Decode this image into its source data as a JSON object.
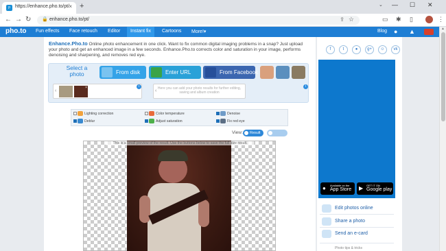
{
  "browser": {
    "tab_title": "https://enhance.pho.to/pt/",
    "url": "enhance.pho.to/pt/",
    "new_tab": "+",
    "close_tab": "×",
    "back": "←",
    "forward": "→",
    "reload": "↻",
    "minimize": "—",
    "maximize": "☐",
    "close_window": "✕"
  },
  "nav": {
    "logo": "pho.to",
    "items": [
      "Fun effects",
      "Face retouch",
      "Editor",
      "Instant fix",
      "Cartoons",
      "More!▾"
    ],
    "active_index": 3,
    "blog": "Blog"
  },
  "intro": {
    "brand": "Enhance.Pho.to",
    "text": " Online photo enhancement in one click. Want to fix common digital imaging problems in a snap? Just upload your photo and get an enhanced image in a few seconds. Enhance.Pho.to corrects color and saturation in your image, performs denoising and sharpening, and removes red eye."
  },
  "upload": {
    "select_photo": "Select a photo",
    "from_disk": "From disk",
    "enter_url": "Enter URL",
    "from_facebook": "From Facebook",
    "hint": "Here you can add your photo results for further editing, saving and album creation"
  },
  "options": [
    {
      "label": "Lighting correction",
      "checked": false
    },
    {
      "label": "Color temperature",
      "checked": false
    },
    {
      "label": "Denoise",
      "checked": true
    },
    {
      "label": "Deblur",
      "checked": true
    },
    {
      "label": "Adjust saturation",
      "checked": true
    },
    {
      "label": "Fix red eye",
      "checked": true
    }
  ],
  "view": {
    "label": "View:",
    "result": "Result",
    "original": "Original"
  },
  "preview": {
    "caption": "This is a small preview of the result. Use the buttons below to save the full size result."
  },
  "sidebar": {
    "social": [
      "f",
      "t",
      "●",
      "g+",
      "☺",
      "vk"
    ],
    "app_store_small": "Available on the",
    "app_store": "App Store",
    "google_small": "GET IT ON",
    "google_play": "Google play",
    "links": [
      "Edit photos online",
      "Share a photo",
      "Send an e-card",
      "Photo tips & tricks"
    ]
  }
}
